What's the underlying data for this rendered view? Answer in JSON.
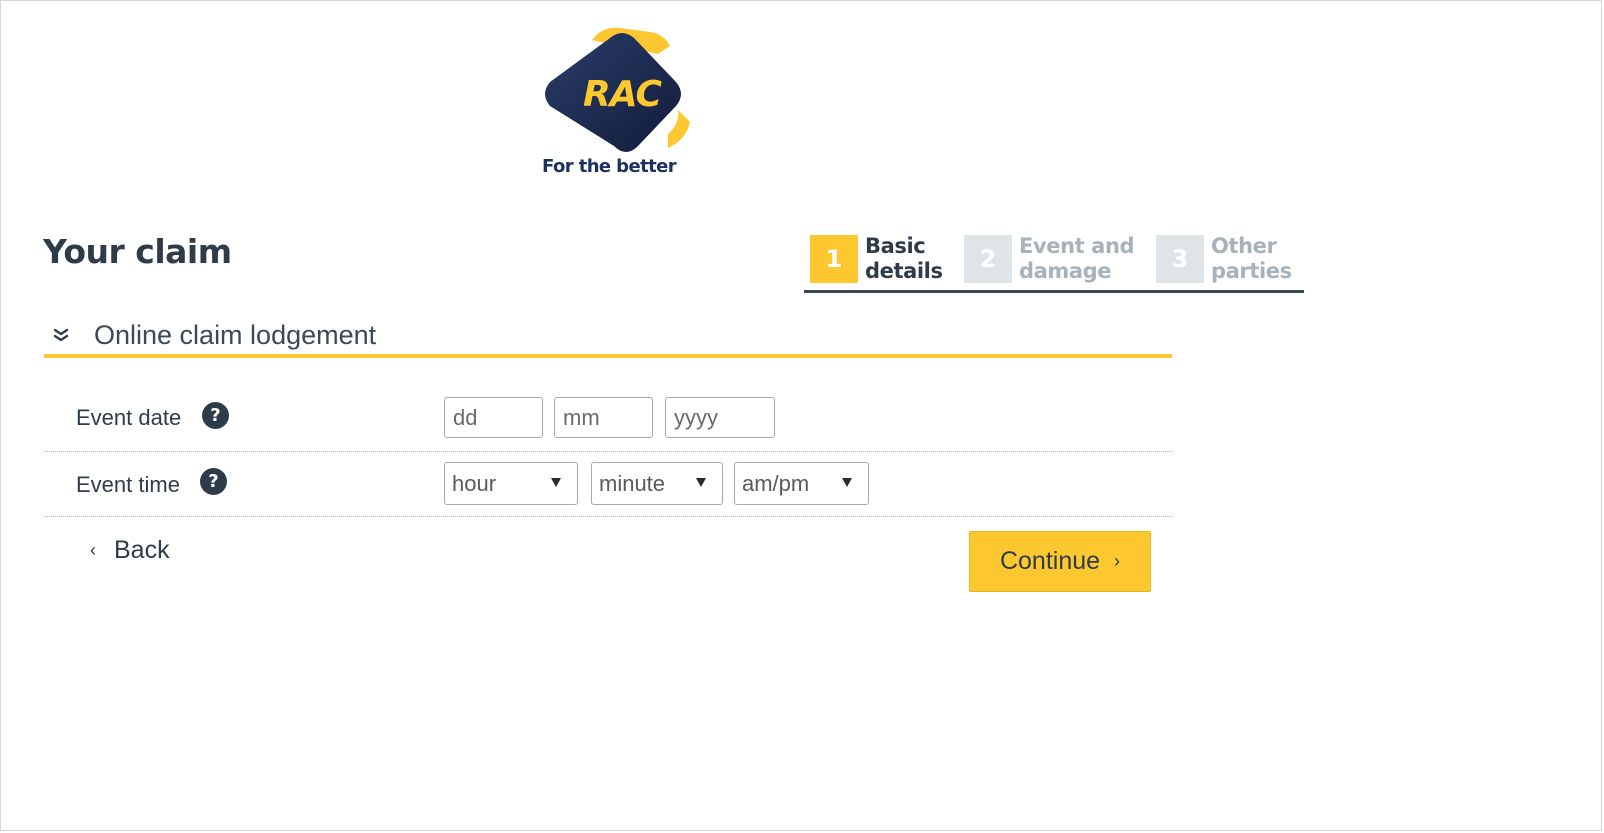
{
  "logo": {
    "wordmark": "RAC",
    "tagline": "For the better"
  },
  "page": {
    "title": "Your claim"
  },
  "stepper": {
    "steps": [
      {
        "number": "1",
        "label": "Basic\ndetails",
        "state": "active"
      },
      {
        "number": "2",
        "label": "Event and\ndamage",
        "state": "inactive"
      },
      {
        "number": "3",
        "label": "Other\nparties",
        "state": "inactive"
      }
    ]
  },
  "section": {
    "title": "Online claim lodgement",
    "icon": "double-chevron-down-icon"
  },
  "form": {
    "event_date": {
      "label": "Event date",
      "help_glyph": "?",
      "day_placeholder": "dd",
      "month_placeholder": "mm",
      "year_placeholder": "yyyy"
    },
    "event_time": {
      "label": "Event time",
      "help_glyph": "?",
      "hour_selected": "hour",
      "minute_selected": "minute",
      "ampm_selected": "am/pm"
    }
  },
  "actions": {
    "back_label": "Back",
    "back_icon": "chevron-left-icon",
    "continue_label": "Continue",
    "continue_icon": "chevron-right-icon"
  },
  "colors": {
    "brand_yellow": "#fdc82f",
    "brand_navy": "#1c2a4a",
    "text_dark": "#2e3c4a",
    "step_inactive_bg": "#dfe4e7",
    "step_inactive_text": "#a8b2ba"
  }
}
